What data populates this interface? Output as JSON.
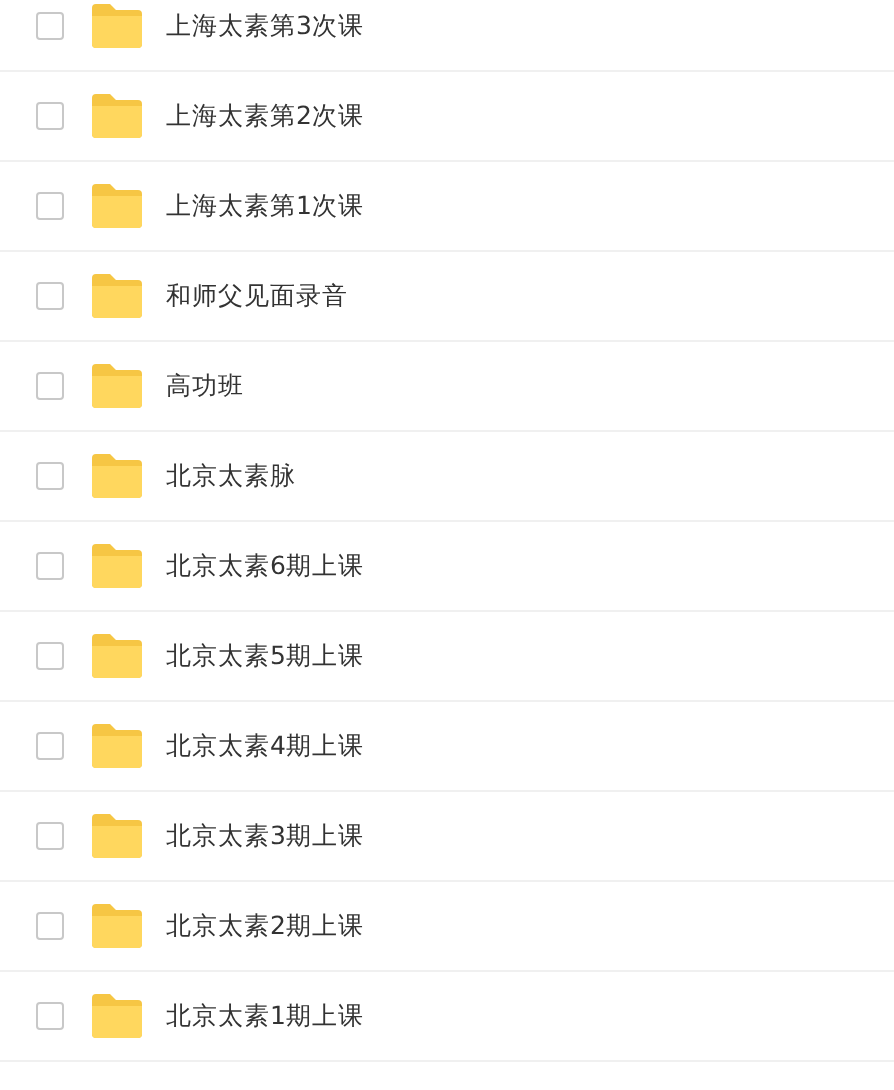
{
  "files": [
    {
      "name": "上海太素第3次课",
      "checked": false
    },
    {
      "name": "上海太素第2次课",
      "checked": false
    },
    {
      "name": "上海太素第1次课",
      "checked": false
    },
    {
      "name": "和师父见面录音",
      "checked": false
    },
    {
      "name": "高功班",
      "checked": false
    },
    {
      "name": "北京太素脉",
      "checked": false
    },
    {
      "name": "北京太素6期上课",
      "checked": false
    },
    {
      "name": "北京太素5期上课",
      "checked": false
    },
    {
      "name": "北京太素4期上课",
      "checked": false
    },
    {
      "name": "北京太素3期上课",
      "checked": false
    },
    {
      "name": "北京太素2期上课",
      "checked": false
    },
    {
      "name": "北京太素1期上课",
      "checked": false
    }
  ]
}
